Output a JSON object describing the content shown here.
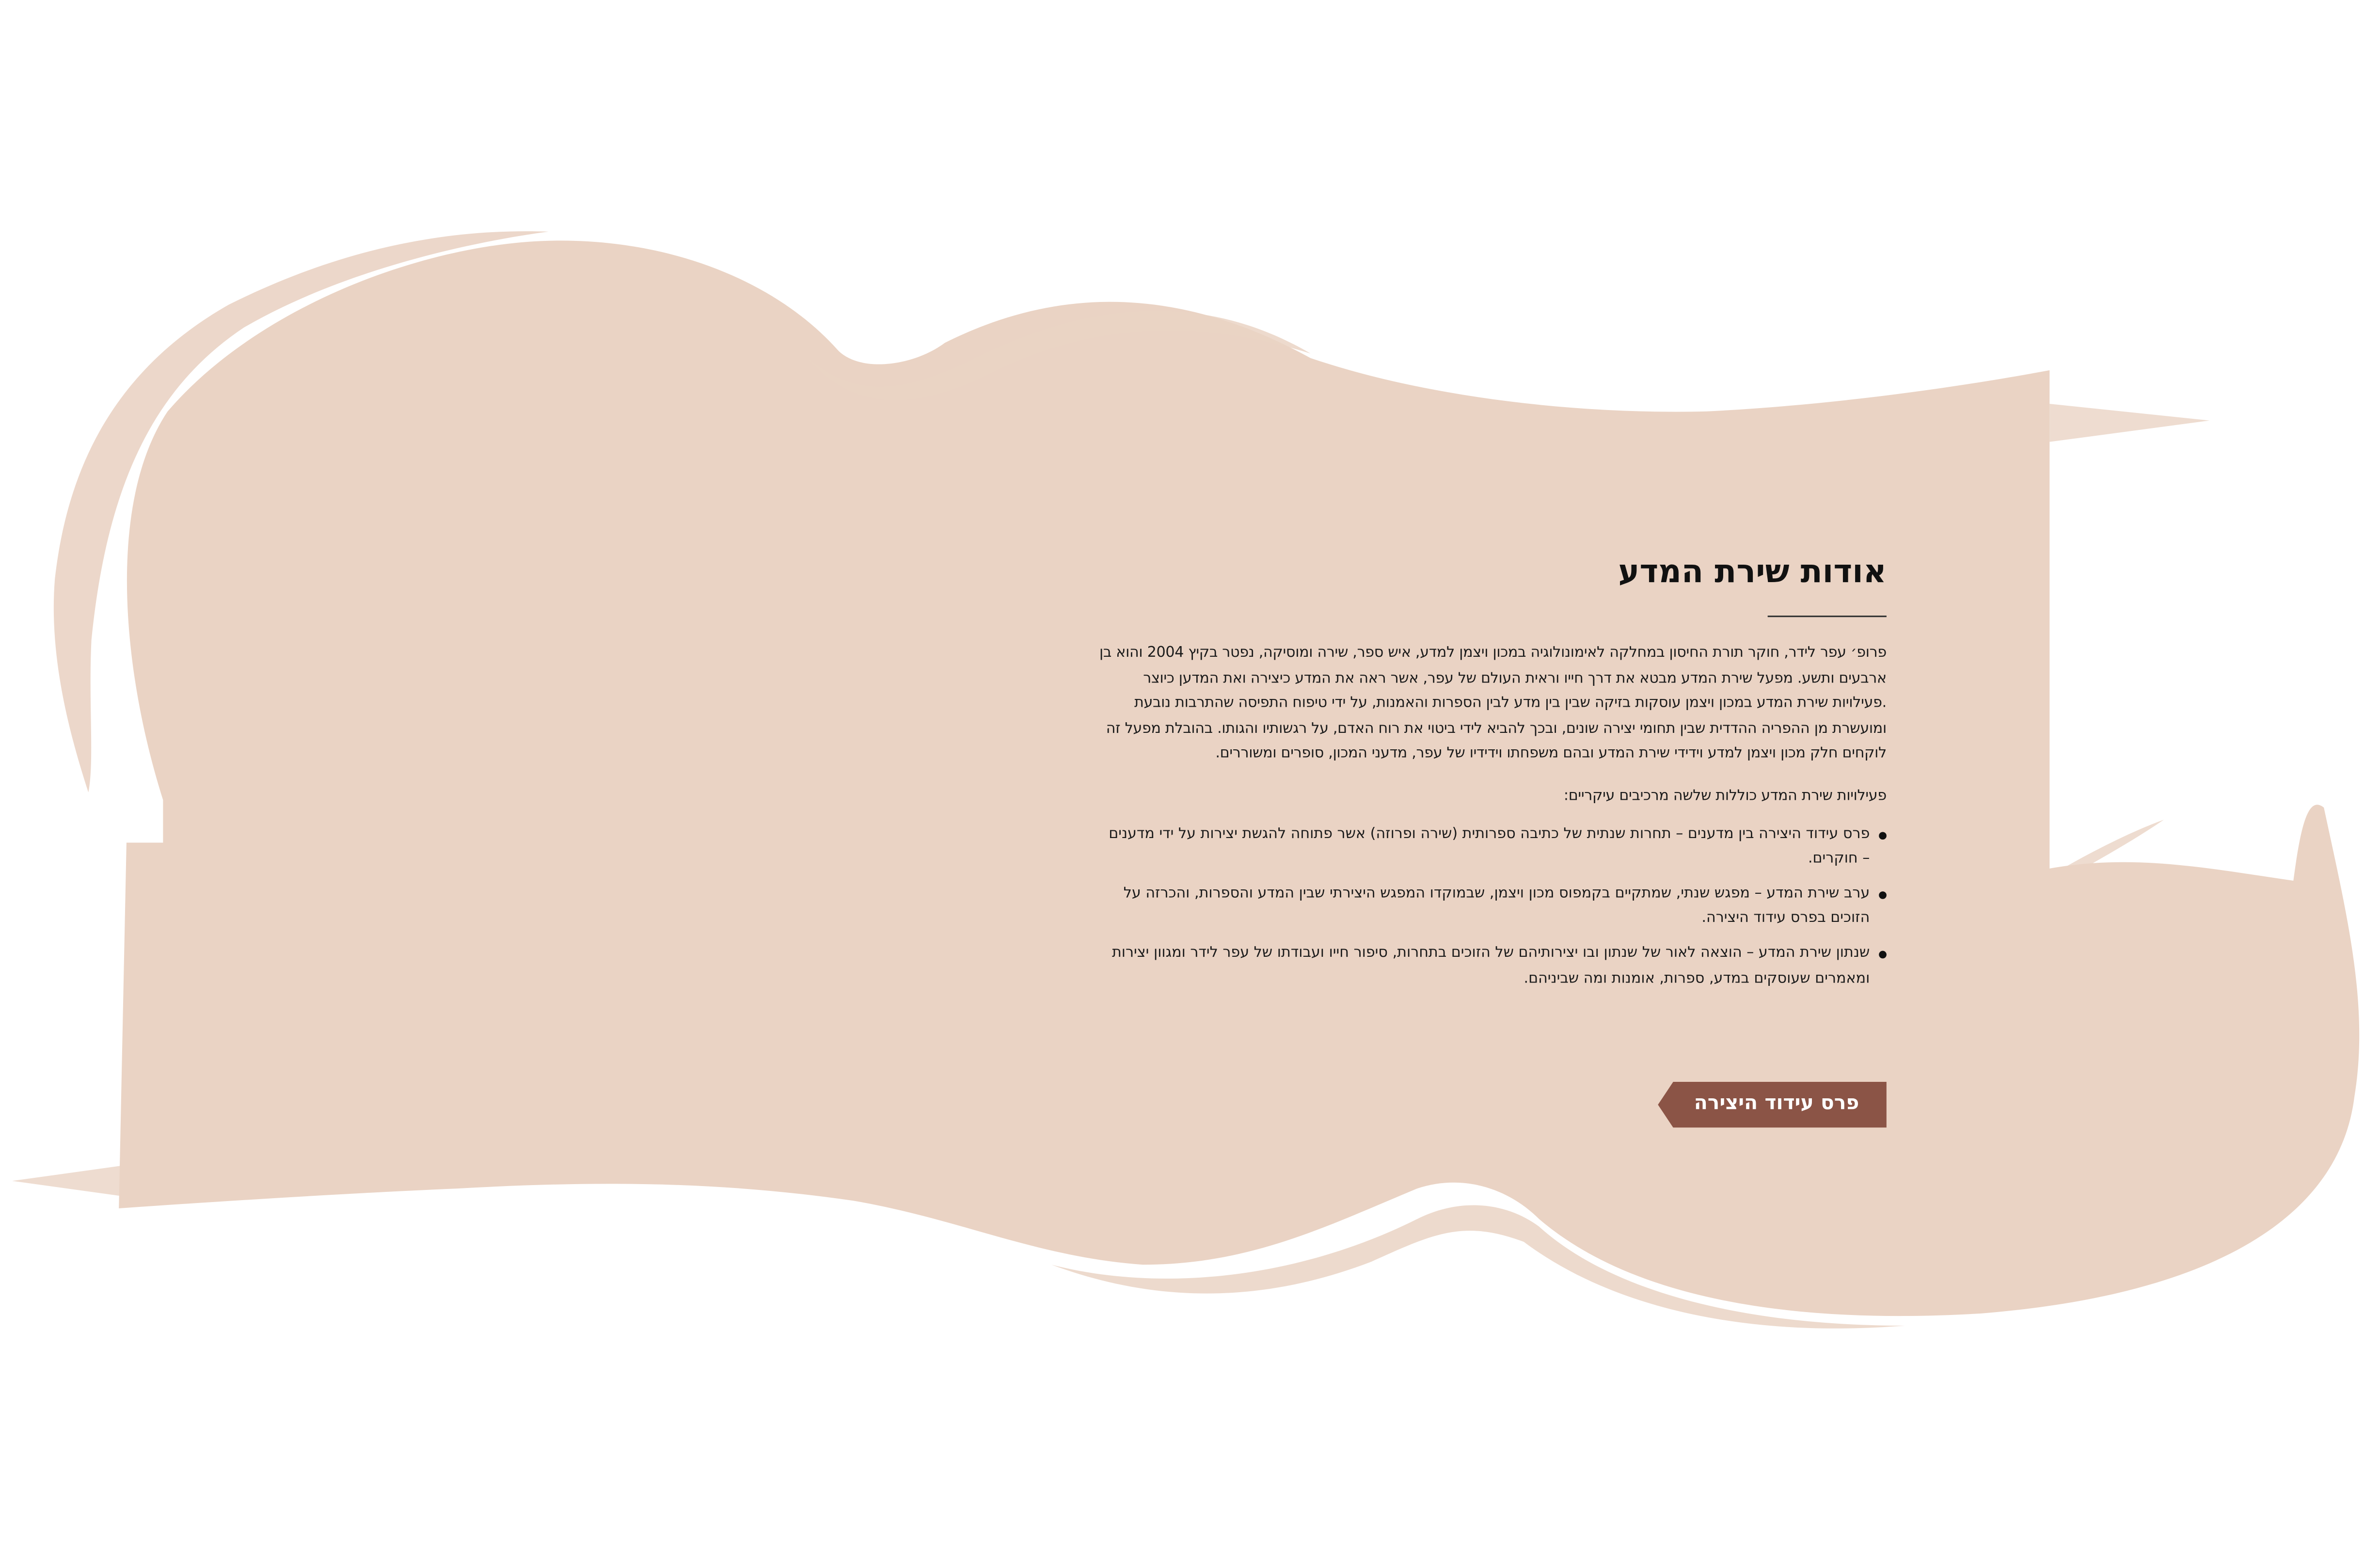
{
  "colors": {
    "blob": "#ead3c4",
    "button": "#8b5446",
    "text": "#1a1a1a"
  },
  "about": {
    "title": "אודות שירת המדע",
    "intro": "פרופ׳ עפר לידר, חוקר תורת החיסון במחלקה לאימונולוגיה במכון ויצמן למדע, איש ספר, שירה ומוסיקה, נפטר בקיץ 2004 והוא בן ארבעים ותשע. מפעל שירת המדע מבטא את דרך חייו וראית העולם של עפר, אשר ראה את המדע כיצירה ואת המדען כיוצר .פעילויות שירת המדע במכון ויצמן עוסקות בזיקה שבין בין מדע לבין הספרות והאמנות, על ידי טיפוח התפיסה שהתרבות נובעת ומועשרת מן ההפריה ההדדית שבין תחומי יצירה שונים, ובכך להביא לידי ביטוי את רוח האדם, על רגשותיו והגותו. בהובלת מפעל זה לוקחים חלק מכון ויצמן למדע וידידי שירת המדע ובהם משפחתו וידידיו של עפר, מדעני המכון, סופרים ומשוררים.",
    "components_intro": "פעילויות שירת המדע כוללות שלשה מרכיבים עיקריים:",
    "components": [
      "פרס עידוד היצירה בין מדענים – תחרות שנתית של כתיבה ספרותית (שירה ופרוזה) אשר פתוחה להגשת יצירות על ידי מדענים – חוקרים.",
      "ערב שירת המדע – מפגש שנתי, שמתקיים בקמפוס מכון ויצמן, שבמוקדו המפגש היצירתי שבין המדע והספרות, והכרזה על הזוכים בפרס עידוד היצירה.",
      "שנתון שירת המדע – הוצאה לאור של שנתון ובו יצירותיהם של הזוכים בתחרות, סיפור חייו ועבודתו של עפר לידר ומגוון יצירות ומאמרים שעוסקים במדע, ספרות, אומנות ומה שביניהם."
    ],
    "button_label": "פרס עידוד היצירה"
  }
}
